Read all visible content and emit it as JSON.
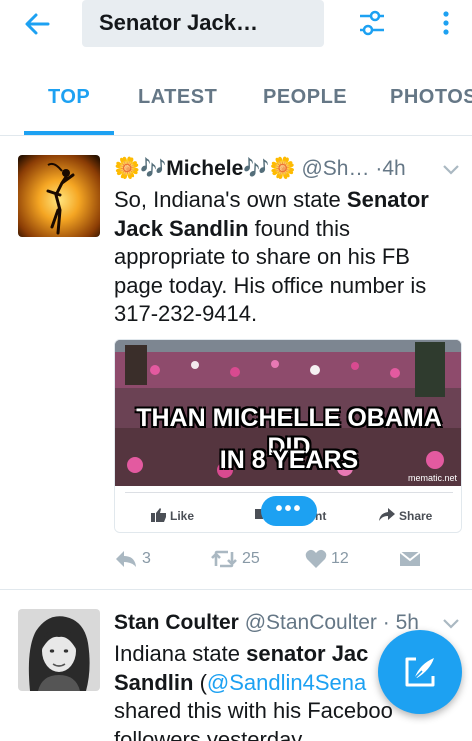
{
  "search": {
    "query": "Senator Jack…"
  },
  "tabs": [
    {
      "label": "TOP",
      "active": true
    },
    {
      "label": "LATEST",
      "active": false
    },
    {
      "label": "PEOPLE",
      "active": false
    },
    {
      "label": "PHOTOS",
      "active": false
    }
  ],
  "tweets": [
    {
      "name": "🌼🎶Michele🎶🌼",
      "handle": "@Sh…",
      "dot": "·",
      "time": "4h",
      "text_parts": [
        "So, Indiana's own state ",
        "Senator Jack Sandlin",
        " found this appropriate to share on his FB page today. His office number is 317-232-9414."
      ],
      "media": {
        "meme_line1": "THAN MICHELLE OBAMA DID",
        "meme_line2": "IN 8 YEARS",
        "credit": "mematic.net",
        "fb_like": "Like",
        "fb_comment": "nt",
        "fb_share": "Share",
        "pill": "•••"
      },
      "replies": "3",
      "retweets": "25",
      "likes": "12"
    },
    {
      "name": "Stan Coulter",
      "handle": "@StanCoulter",
      "dot": "·",
      "time": "5h",
      "text_parts": [
        "Indiana state ",
        "senator Jac",
        "Sandlin",
        " (",
        "@Sandlin4Sena",
        "shared this with his Faceboo",
        "followers yesterday"
      ]
    }
  ],
  "colors": {
    "accent": "#1da1f2",
    "muted": "#657786",
    "action": "#8899a6"
  },
  "icons": [
    "back-arrow-icon",
    "filter-icon",
    "more-vertical-icon",
    "chevron-down-icon",
    "reply-icon",
    "retweet-icon",
    "heart-icon",
    "dm-icon",
    "compose-icon",
    "thumbs-up-icon",
    "share-arrow-icon"
  ]
}
